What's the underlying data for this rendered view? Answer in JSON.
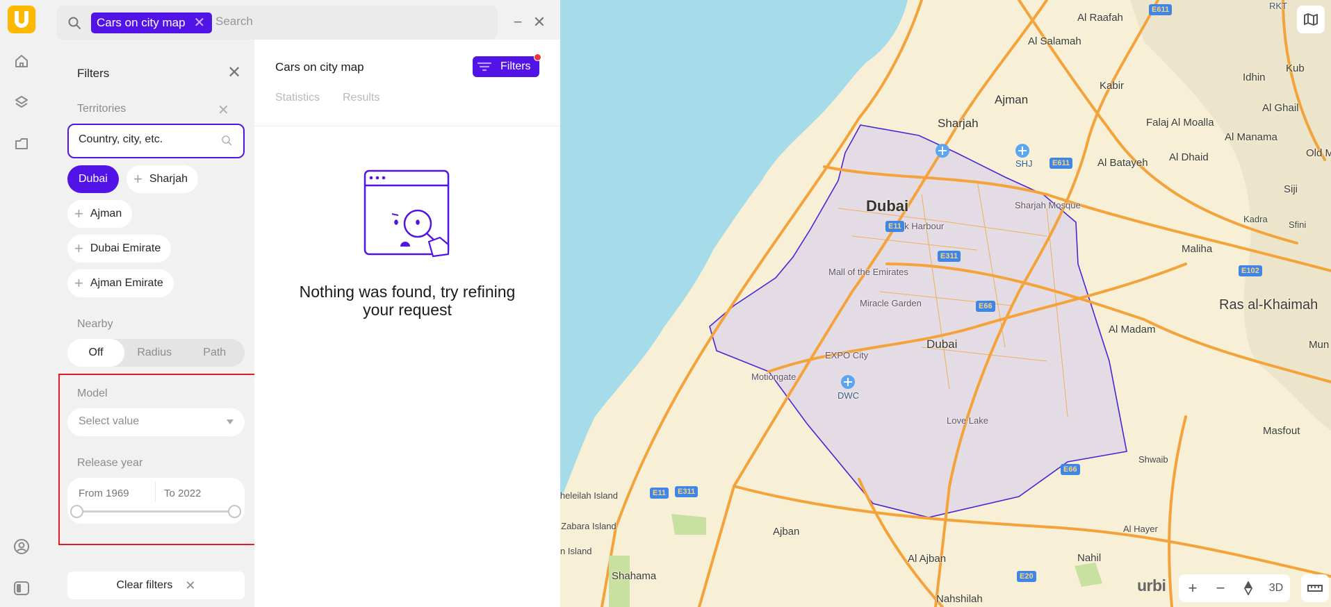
{
  "app": {
    "logo_letter": "U",
    "brand_color": "#5113e6",
    "logo_color": "#ffb800"
  },
  "rail": {
    "items": [
      {
        "name": "home",
        "icon": "home-icon"
      },
      {
        "name": "layers",
        "icon": "layers-icon"
      },
      {
        "name": "folder",
        "icon": "folder-icon"
      }
    ],
    "bottom_items": [
      {
        "name": "account",
        "icon": "user-circle-icon"
      },
      {
        "name": "toggle-panel",
        "icon": "sidebar-toggle-icon"
      }
    ]
  },
  "search": {
    "query_chip": "Cars on city map",
    "placeholder": "Search",
    "value": ""
  },
  "filters_panel": {
    "title": "Filters",
    "territories": {
      "label": "Territories",
      "input_placeholder": "Country, city, etc.",
      "chips": [
        {
          "label": "Dubai",
          "selected": true
        },
        {
          "label": "Sharjah",
          "selected": false
        },
        {
          "label": "Ajman",
          "selected": false
        },
        {
          "label": "Dubai Emirate",
          "selected": false
        },
        {
          "label": "Ajman Emirate",
          "selected": false
        }
      ]
    },
    "nearby": {
      "label": "Nearby",
      "options": [
        "Off",
        "Radius",
        "Path"
      ],
      "selected": "Off"
    },
    "model": {
      "label": "Model",
      "placeholder": "Select value"
    },
    "release_year": {
      "label": "Release year",
      "from_label": "From 1969",
      "to_label": "To 2022",
      "min": 1969,
      "max": 2022,
      "from": 1969,
      "to": 2022
    },
    "clear_label": "Clear filters"
  },
  "results_panel": {
    "title": "Cars on city map",
    "filters_button": "Filters",
    "filters_active_indicator": true,
    "tabs": [
      "Statistics",
      "Results"
    ],
    "empty_message": "Nothing was found, try refining your request"
  },
  "map": {
    "labels": {
      "dubai_big": "Dubai",
      "dubai_city": "Dubai",
      "sharjah": "Sharjah",
      "ajman": "Ajman",
      "al_raafah": "Al Raafah",
      "al_salamah": "Al Salamah",
      "kabir": "Kabir",
      "idhin": "Idhin",
      "kub": "Kub",
      "al_ghail": "Al Ghail",
      "falaj": "Falaj Al Moalla",
      "al_manama": "Al Manama",
      "old_m": "Old M",
      "al_batayeh": "Al Batayeh",
      "al_dhaid": "Al Dhaid",
      "siji": "Siji",
      "kadra": "Kadra",
      "sfini": "Sfini",
      "maliha": "Maliha",
      "ras": "Ras al-Khaimah",
      "mun": "Mun",
      "al_madam": "Al Madam",
      "masfout": "Masfout",
      "shwaib": "Shwaib",
      "al_hayer": "Al Hayer",
      "nahil": "Nahil",
      "al_ajban": "Al Ajban",
      "nahshilah": "Nahshilah",
      "ajban": "Ajban",
      "shahama": "Shahama",
      "sheleilah": "Al Sheleilah Island",
      "zabara": "Al Zabara Island",
      "n_island": "n Island",
      "rkt": "RKT",
      "shj": "SHJ",
      "dwc": "DWC",
      "creek": "Creek Harbour",
      "mall": "Mall of the Emirates",
      "miracle": "Miracle Garden",
      "expo": "EXPO City",
      "motiongate": "Motiongate",
      "love_lake": "Love Lake",
      "sharjah_mosque": "Sharjah Mosque"
    },
    "shields": {
      "e611_top": "E611",
      "e611": "E611",
      "e11": "E11",
      "e311": "E311",
      "e66": "E66",
      "e66_b": "E66",
      "e102": "E102",
      "e11_b": "E11",
      "e311_b": "E311",
      "e20": "E20"
    },
    "brand": "urbi",
    "controls": {
      "zoom_in": "+",
      "zoom_out": "−",
      "mode_3d": "3D"
    }
  }
}
